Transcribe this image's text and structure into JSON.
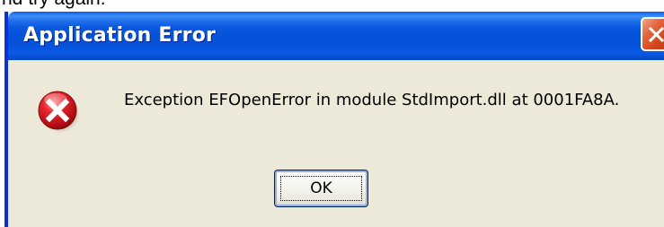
{
  "background": {
    "partial_text": "nd try again."
  },
  "dialog": {
    "title": "Application Error",
    "message": "Exception EFOpenError in module StdImport.dll at 0001FA8A.",
    "icon": "error-icon",
    "ok_label": "OK"
  },
  "colors": {
    "titlebar": "#0450d6",
    "dialog_background": "#ece9d8",
    "close_button": "#d1441c",
    "error_icon": "#d2161e"
  }
}
